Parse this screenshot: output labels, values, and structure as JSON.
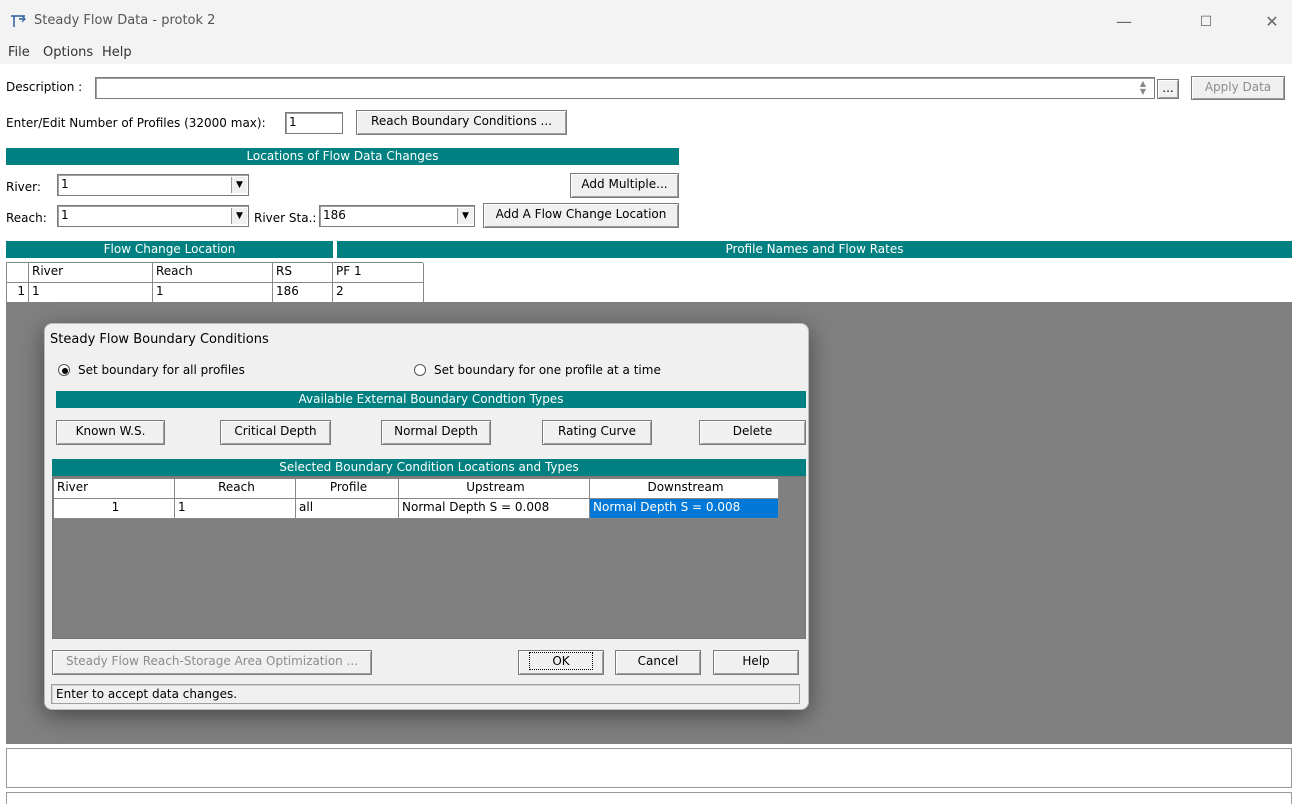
{
  "window": {
    "title": "Steady Flow Data - protok 2",
    "minimize": "—",
    "maximize": "☐",
    "close": "✕"
  },
  "menu": {
    "file": "File",
    "options": "Options",
    "help": "Help"
  },
  "description": {
    "label": "Description :",
    "value": "",
    "ellipsis": "...",
    "apply_label": "Apply Data"
  },
  "profiles": {
    "label": "Enter/Edit Number of Profiles (32000 max):",
    "value": "1",
    "reach_bc_button": "Reach Boundary Conditions ..."
  },
  "locations": {
    "header": "Locations of Flow Data Changes",
    "river_label": "River:",
    "river_value": "1",
    "reach_label": "Reach:",
    "reach_value": "1",
    "river_sta_label": "River Sta.:",
    "river_sta_value": "186",
    "add_multiple": "Add Multiple...",
    "add_location": "Add A Flow Change Location"
  },
  "flow_table": {
    "left_header": "Flow Change Location",
    "right_header": "Profile Names and Flow Rates",
    "columns": [
      "River",
      "Reach",
      "RS",
      "PF 1"
    ],
    "rows": [
      {
        "index": "1",
        "river": "1",
        "reach": "1",
        "rs": "186",
        "pf1": "2"
      }
    ]
  },
  "dialog": {
    "title": "Steady Flow Boundary Conditions",
    "radio_all": "Set boundary for all profiles",
    "radio_one": "Set boundary for one profile at a time",
    "types_header": "Available External Boundary Condtion Types",
    "known_ws": "Known W.S.",
    "critical_depth": "Critical Depth",
    "normal_depth": "Normal Depth",
    "rating_curve": "Rating Curve",
    "delete": "Delete",
    "selected_header": "Selected Boundary Condition Locations and Types",
    "columns": [
      "River",
      "Reach",
      "Profile",
      "Upstream",
      "Downstream"
    ],
    "rows": [
      {
        "river": "1",
        "reach": "1",
        "profile": "all",
        "upstream": "Normal Depth S = 0.008",
        "downstream": "Normal Depth S = 0.008"
      }
    ],
    "optimization_button": "Steady Flow Reach-Storage Area Optimization ...",
    "ok": "OK",
    "cancel": "Cancel",
    "help": "Help",
    "status": "Enter to accept data changes."
  },
  "colors": {
    "teal": "#008080",
    "selection": "#0078d7",
    "grey_area": "#808080"
  }
}
